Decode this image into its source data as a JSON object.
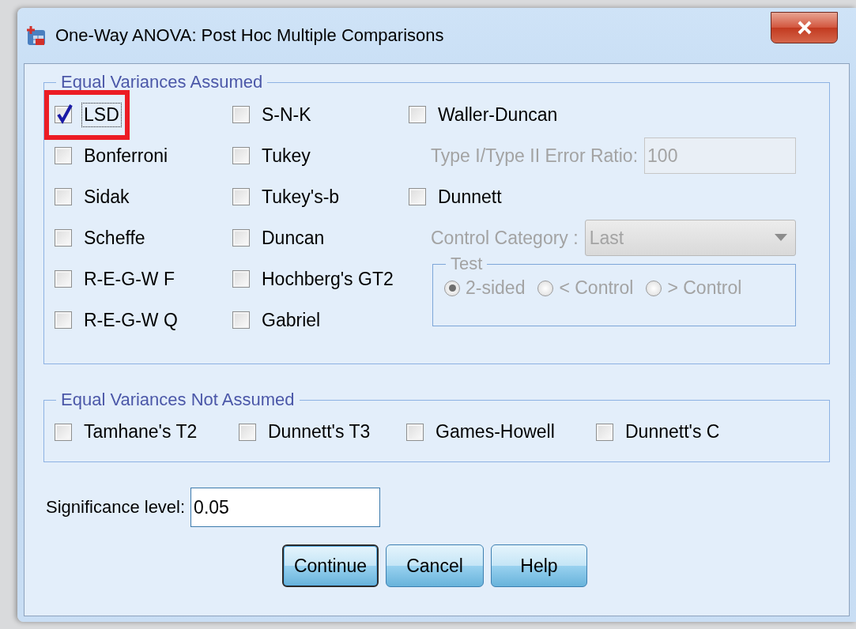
{
  "window": {
    "title": "One-Way ANOVA: Post Hoc Multiple Comparisons"
  },
  "equal_variances_assumed": {
    "title": "Equal Variances Assumed",
    "columns": [
      [
        {
          "kind": "checkbox",
          "label": "LSD",
          "checked": true,
          "focused": true,
          "highlighted": true
        },
        {
          "kind": "checkbox",
          "label": "Bonferroni",
          "checked": false,
          "focused": false,
          "highlighted": false
        },
        {
          "kind": "checkbox",
          "label": "Sidak",
          "checked": false,
          "focused": false,
          "highlighted": false
        },
        {
          "kind": "checkbox",
          "label": "Scheffe",
          "checked": false,
          "focused": false,
          "highlighted": false
        },
        {
          "kind": "checkbox",
          "label": "R-E-G-W F",
          "checked": false,
          "focused": false,
          "highlighted": false
        },
        {
          "kind": "checkbox",
          "label": "R-E-G-W Q",
          "checked": false,
          "focused": false,
          "highlighted": false
        }
      ],
      [
        {
          "kind": "checkbox",
          "label": "S-N-K",
          "checked": false,
          "focused": false,
          "highlighted": false
        },
        {
          "kind": "checkbox",
          "label": "Tukey",
          "checked": false,
          "focused": false,
          "highlighted": false
        },
        {
          "kind": "checkbox",
          "label": "Tukey's-b",
          "checked": false,
          "focused": false,
          "highlighted": false
        },
        {
          "kind": "checkbox",
          "label": "Duncan",
          "checked": false,
          "focused": false,
          "highlighted": false
        },
        {
          "kind": "checkbox",
          "label": "Hochberg's GT2",
          "checked": false,
          "focused": false,
          "highlighted": false
        },
        {
          "kind": "checkbox",
          "label": "Gabriel",
          "checked": false,
          "focused": false,
          "highlighted": false
        }
      ],
      [
        {
          "kind": "checkbox",
          "label": "Waller-Duncan",
          "checked": false,
          "focused": false,
          "highlighted": false
        },
        {
          "kind": "field",
          "label": "Type I/Type II Error Ratio:",
          "value": "100",
          "disabled": true
        },
        {
          "kind": "checkbox",
          "label": "Dunnett",
          "checked": false,
          "focused": false,
          "highlighted": false
        },
        {
          "kind": "dropdown",
          "label": "Control Category :",
          "value": "Last",
          "disabled": true
        },
        {
          "kind": "group",
          "title": "Test",
          "disabled": true,
          "options": [
            {
              "label": "2-sided",
              "selected": true
            },
            {
              "label": "< Control",
              "selected": false
            },
            {
              "label": "> Control",
              "selected": false
            }
          ]
        }
      ]
    ]
  },
  "equal_variances_not_assumed": {
    "title": "Equal Variances Not Assumed",
    "items": [
      {
        "label": "Tamhane's T2",
        "checked": false
      },
      {
        "label": "Dunnett's T3",
        "checked": false
      },
      {
        "label": "Games-Howell",
        "checked": false
      },
      {
        "label": "Dunnett's C",
        "checked": false
      }
    ]
  },
  "significance": {
    "label": "Significance level:",
    "value": "0.05"
  },
  "buttons": [
    {
      "label": "Continue",
      "default": true
    },
    {
      "label": "Cancel",
      "default": false
    },
    {
      "label": "Help",
      "default": false
    }
  ]
}
